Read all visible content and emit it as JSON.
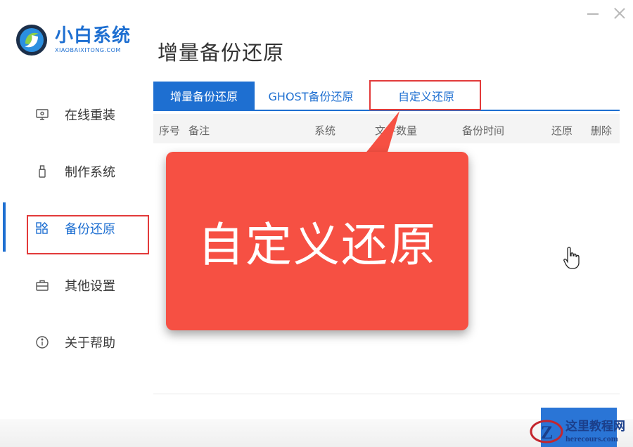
{
  "window": {
    "controls": [
      "minimize-icon",
      "close-icon"
    ]
  },
  "app": {
    "name": "小白系统",
    "domain": "XIAOBAIXITONG.COM"
  },
  "sidebar": {
    "items": [
      {
        "label": "在线重装",
        "icon": "monitor-icon"
      },
      {
        "label": "制作系统",
        "icon": "usb-drive-icon"
      },
      {
        "label": "备份还原",
        "icon": "grid-icon",
        "active": true
      },
      {
        "label": "其他设置",
        "icon": "briefcase-icon"
      },
      {
        "label": "关于帮助",
        "icon": "info-icon"
      }
    ]
  },
  "main": {
    "title": "增量备份还原",
    "tabs": [
      {
        "label": "增量备份还原",
        "active": true
      },
      {
        "label": "GHOST备份还原"
      },
      {
        "label": "自定义还原"
      }
    ],
    "table": {
      "columns": [
        "序号",
        "备注",
        "系统",
        "文件数量",
        "备份时间",
        "还原",
        "删除"
      ]
    }
  },
  "callout": {
    "text": "自定义还原"
  },
  "watermark": {
    "title": "这里教程网",
    "url": "herecours.com"
  },
  "colors": {
    "accent": "#1e6fd1",
    "highlight_border": "#e23a3a",
    "callout_bg": "#f65043"
  }
}
